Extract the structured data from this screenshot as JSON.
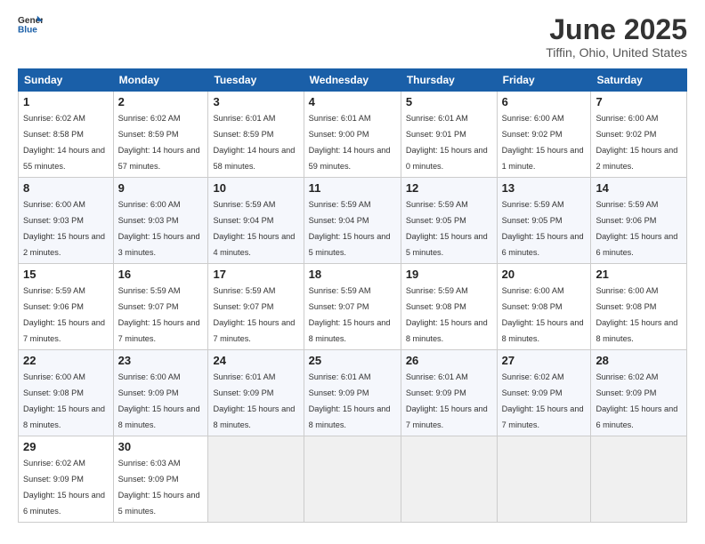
{
  "logo": {
    "general": "General",
    "blue": "Blue"
  },
  "title": {
    "month_year": "June 2025",
    "location": "Tiffin, Ohio, United States"
  },
  "headers": [
    "Sunday",
    "Monday",
    "Tuesday",
    "Wednesday",
    "Thursday",
    "Friday",
    "Saturday"
  ],
  "weeks": [
    [
      {
        "num": "1",
        "sunrise": "6:02 AM",
        "sunset": "8:58 PM",
        "daylight": "14 hours and 55 minutes."
      },
      {
        "num": "2",
        "sunrise": "6:02 AM",
        "sunset": "8:59 PM",
        "daylight": "14 hours and 57 minutes."
      },
      {
        "num": "3",
        "sunrise": "6:01 AM",
        "sunset": "8:59 PM",
        "daylight": "14 hours and 58 minutes."
      },
      {
        "num": "4",
        "sunrise": "6:01 AM",
        "sunset": "9:00 PM",
        "daylight": "14 hours and 59 minutes."
      },
      {
        "num": "5",
        "sunrise": "6:01 AM",
        "sunset": "9:01 PM",
        "daylight": "15 hours and 0 minutes."
      },
      {
        "num": "6",
        "sunrise": "6:00 AM",
        "sunset": "9:02 PM",
        "daylight": "15 hours and 1 minute."
      },
      {
        "num": "7",
        "sunrise": "6:00 AM",
        "sunset": "9:02 PM",
        "daylight": "15 hours and 2 minutes."
      }
    ],
    [
      {
        "num": "8",
        "sunrise": "6:00 AM",
        "sunset": "9:03 PM",
        "daylight": "15 hours and 2 minutes."
      },
      {
        "num": "9",
        "sunrise": "6:00 AM",
        "sunset": "9:03 PM",
        "daylight": "15 hours and 3 minutes."
      },
      {
        "num": "10",
        "sunrise": "5:59 AM",
        "sunset": "9:04 PM",
        "daylight": "15 hours and 4 minutes."
      },
      {
        "num": "11",
        "sunrise": "5:59 AM",
        "sunset": "9:04 PM",
        "daylight": "15 hours and 5 minutes."
      },
      {
        "num": "12",
        "sunrise": "5:59 AM",
        "sunset": "9:05 PM",
        "daylight": "15 hours and 5 minutes."
      },
      {
        "num": "13",
        "sunrise": "5:59 AM",
        "sunset": "9:05 PM",
        "daylight": "15 hours and 6 minutes."
      },
      {
        "num": "14",
        "sunrise": "5:59 AM",
        "sunset": "9:06 PM",
        "daylight": "15 hours and 6 minutes."
      }
    ],
    [
      {
        "num": "15",
        "sunrise": "5:59 AM",
        "sunset": "9:06 PM",
        "daylight": "15 hours and 7 minutes."
      },
      {
        "num": "16",
        "sunrise": "5:59 AM",
        "sunset": "9:07 PM",
        "daylight": "15 hours and 7 minutes."
      },
      {
        "num": "17",
        "sunrise": "5:59 AM",
        "sunset": "9:07 PM",
        "daylight": "15 hours and 7 minutes."
      },
      {
        "num": "18",
        "sunrise": "5:59 AM",
        "sunset": "9:07 PM",
        "daylight": "15 hours and 8 minutes."
      },
      {
        "num": "19",
        "sunrise": "5:59 AM",
        "sunset": "9:08 PM",
        "daylight": "15 hours and 8 minutes."
      },
      {
        "num": "20",
        "sunrise": "6:00 AM",
        "sunset": "9:08 PM",
        "daylight": "15 hours and 8 minutes."
      },
      {
        "num": "21",
        "sunrise": "6:00 AM",
        "sunset": "9:08 PM",
        "daylight": "15 hours and 8 minutes."
      }
    ],
    [
      {
        "num": "22",
        "sunrise": "6:00 AM",
        "sunset": "9:08 PM",
        "daylight": "15 hours and 8 minutes."
      },
      {
        "num": "23",
        "sunrise": "6:00 AM",
        "sunset": "9:09 PM",
        "daylight": "15 hours and 8 minutes."
      },
      {
        "num": "24",
        "sunrise": "6:01 AM",
        "sunset": "9:09 PM",
        "daylight": "15 hours and 8 minutes."
      },
      {
        "num": "25",
        "sunrise": "6:01 AM",
        "sunset": "9:09 PM",
        "daylight": "15 hours and 8 minutes."
      },
      {
        "num": "26",
        "sunrise": "6:01 AM",
        "sunset": "9:09 PM",
        "daylight": "15 hours and 7 minutes."
      },
      {
        "num": "27",
        "sunrise": "6:02 AM",
        "sunset": "9:09 PM",
        "daylight": "15 hours and 7 minutes."
      },
      {
        "num": "28",
        "sunrise": "6:02 AM",
        "sunset": "9:09 PM",
        "daylight": "15 hours and 6 minutes."
      }
    ],
    [
      {
        "num": "29",
        "sunrise": "6:02 AM",
        "sunset": "9:09 PM",
        "daylight": "15 hours and 6 minutes."
      },
      {
        "num": "30",
        "sunrise": "6:03 AM",
        "sunset": "9:09 PM",
        "daylight": "15 hours and 5 minutes."
      },
      null,
      null,
      null,
      null,
      null
    ]
  ]
}
